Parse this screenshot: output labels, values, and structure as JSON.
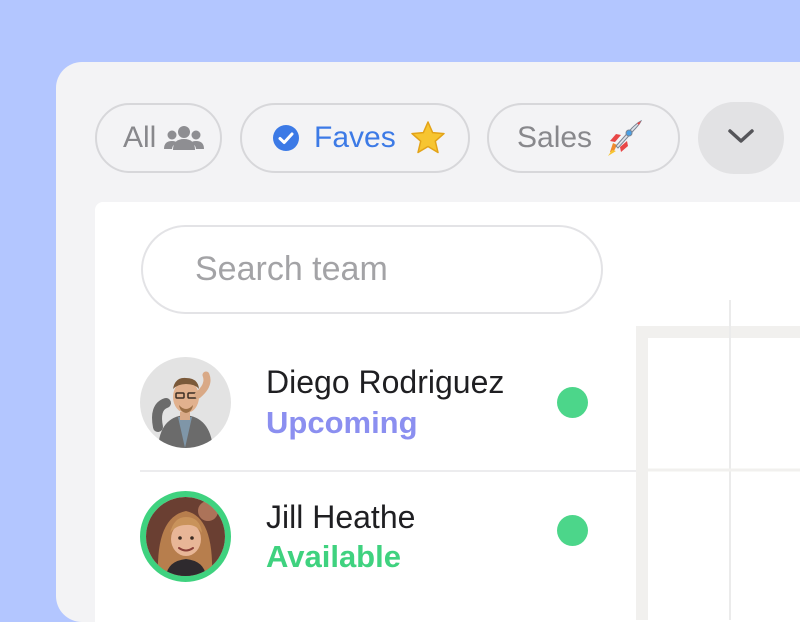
{
  "filters": {
    "all": {
      "label": "All",
      "icon": "group-icon"
    },
    "faves": {
      "label": "Faves",
      "icon": "star-icon",
      "selected": true
    },
    "sales": {
      "label": "Sales",
      "icon": "rocket-icon"
    },
    "more_icon": "chevron-down-icon"
  },
  "search": {
    "placeholder": "Search team",
    "value": ""
  },
  "team": [
    {
      "name": "Diego Rodriguez",
      "status": "Upcoming",
      "status_color": "#8b8ff0",
      "dot_color": "#4cd68a"
    },
    {
      "name": "Jill Heathe",
      "status": "Available",
      "status_color": "#3fd27f",
      "dot_color": "#4cd68a",
      "avatar_ring": "#3fd27f"
    }
  ],
  "colors": {
    "background": "#b3c6ff",
    "accent": "#3c7ae6",
    "available": "#3fd27f",
    "upcoming": "#8b8ff0"
  }
}
